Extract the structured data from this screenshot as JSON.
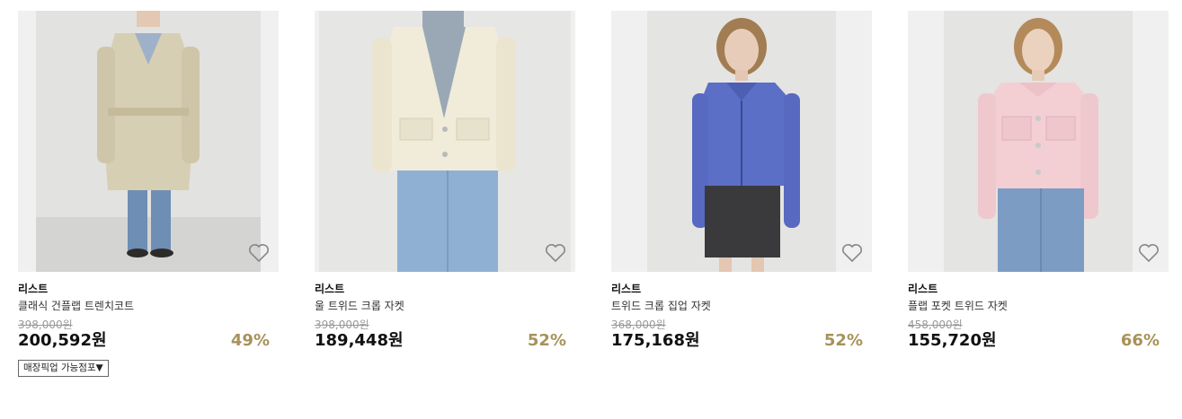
{
  "products": [
    {
      "brand": "리스트",
      "name": "클래식 건플랩 트렌치코트",
      "original_price": "398,000원",
      "price": "200,592원",
      "discount": "49%",
      "pickup_label": "매장픽업 가능점포"
    },
    {
      "brand": "리스트",
      "name": "울 트위드 크롭 자켓",
      "original_price": "398,000원",
      "price": "189,448원",
      "discount": "52%"
    },
    {
      "brand": "리스트",
      "name": "트위드 크롭 집업 자켓",
      "original_price": "368,000원",
      "price": "175,168원",
      "discount": "52%"
    },
    {
      "brand": "리스트",
      "name": "플랩 포켓 트위드 자켓",
      "original_price": "458,000원",
      "price": "155,720원",
      "discount": "66%"
    }
  ],
  "colors": {
    "discount": "#a7925a",
    "original_price": "#999999",
    "photo_background": "#ececec"
  },
  "icons": [
    "heart-outline-icon",
    "caret-down-icon"
  ]
}
